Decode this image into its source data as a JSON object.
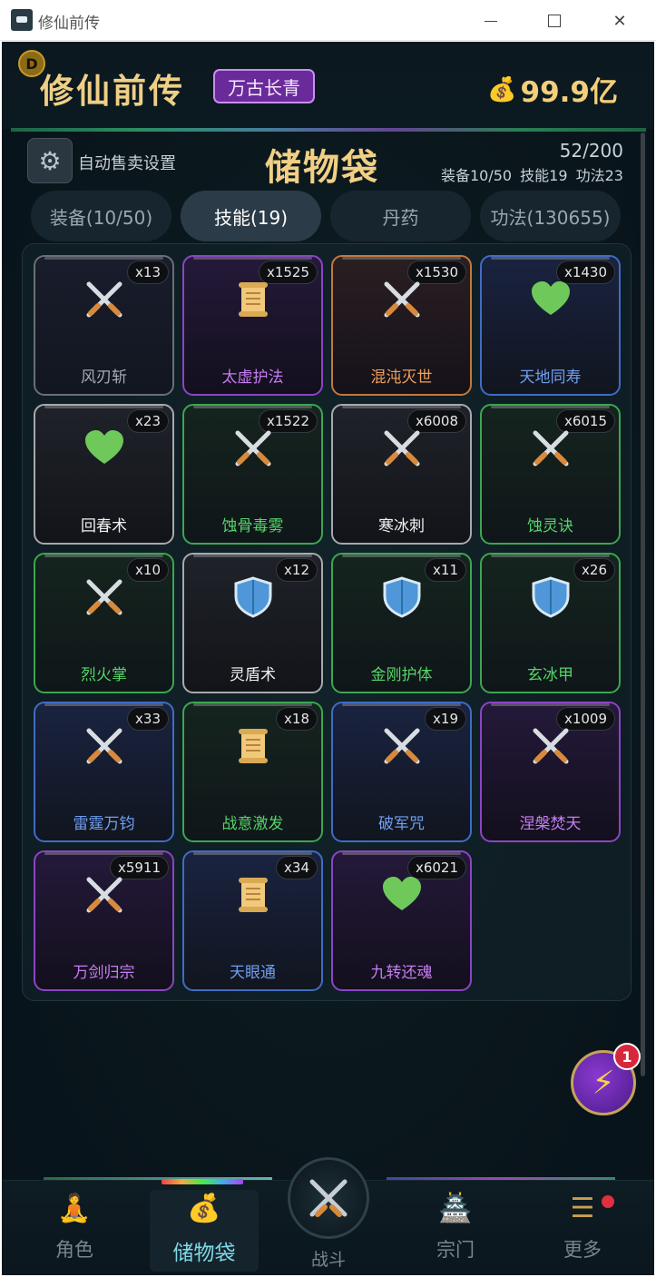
{
  "window": {
    "title": "修仙前传",
    "min": "—",
    "max": "☐",
    "close": "✕"
  },
  "header": {
    "avatar_letter": "D",
    "title": "修仙前传",
    "rank": "万古长青",
    "gold": "99.9亿",
    "gold_icon": "money-bag-icon"
  },
  "bag": {
    "settings_label": "自动售卖设置",
    "title": "储物袋",
    "capacity": "52/200",
    "stats": "装备10/50 技能19 功法23"
  },
  "tabs": [
    {
      "label": "装备(10/50)",
      "active": false
    },
    {
      "label": "技能(19)",
      "active": true
    },
    {
      "label": "丹药",
      "active": false
    },
    {
      "label": "功法(130655)",
      "active": false
    }
  ],
  "items": [
    {
      "name": "风刃斩",
      "qty": "x13",
      "rarity": "gray",
      "icon": "crossed-swords-icon"
    },
    {
      "name": "太虚护法",
      "qty": "x1525",
      "rarity": "purple",
      "icon": "scroll-icon"
    },
    {
      "name": "混沌灭世",
      "qty": "x1530",
      "rarity": "orange",
      "icon": "crossed-swords-icon"
    },
    {
      "name": "天地同寿",
      "qty": "x1430",
      "rarity": "blue",
      "icon": "heart-icon"
    },
    {
      "name": "回春术",
      "qty": "x23",
      "rarity": "white",
      "icon": "heart-icon"
    },
    {
      "name": "蚀骨毒雾",
      "qty": "x1522",
      "rarity": "green",
      "icon": "crossed-swords-icon"
    },
    {
      "name": "寒冰刺",
      "qty": "x6008",
      "rarity": "white",
      "icon": "crossed-swords-icon"
    },
    {
      "name": "蚀灵诀",
      "qty": "x6015",
      "rarity": "green",
      "icon": "crossed-swords-icon"
    },
    {
      "name": "烈火掌",
      "qty": "x10",
      "rarity": "green",
      "icon": "crossed-swords-icon"
    },
    {
      "name": "灵盾术",
      "qty": "x12",
      "rarity": "white",
      "icon": "shield-icon"
    },
    {
      "name": "金刚护体",
      "qty": "x11",
      "rarity": "green",
      "icon": "shield-icon"
    },
    {
      "name": "玄冰甲",
      "qty": "x26",
      "rarity": "green",
      "icon": "shield-icon"
    },
    {
      "name": "雷霆万钧",
      "qty": "x33",
      "rarity": "blue",
      "icon": "crossed-swords-icon"
    },
    {
      "name": "战意激发",
      "qty": "x18",
      "rarity": "green",
      "icon": "scroll-icon"
    },
    {
      "name": "破军咒",
      "qty": "x19",
      "rarity": "blue",
      "icon": "crossed-swords-icon"
    },
    {
      "name": "涅槃焚天",
      "qty": "x1009",
      "rarity": "purple",
      "icon": "crossed-swords-icon"
    },
    {
      "name": "万剑归宗",
      "qty": "x5911",
      "rarity": "purple",
      "icon": "crossed-swords-icon"
    },
    {
      "name": "天眼通",
      "qty": "x34",
      "rarity": "blue",
      "icon": "scroll-icon"
    },
    {
      "name": "九转还魂",
      "qty": "x6021",
      "rarity": "purple",
      "icon": "heart-icon"
    }
  ],
  "fab": {
    "badge": "1",
    "icon": "lightning-icon"
  },
  "nav": {
    "items": [
      {
        "label": "角色",
        "icon": "meditation-icon"
      },
      {
        "label": "储物袋",
        "icon": "bag-icon",
        "active": true
      },
      {
        "label": "战斗",
        "icon": "crossed-swords-icon"
      },
      {
        "label": "宗门",
        "icon": "temple-icon"
      },
      {
        "label": "更多",
        "icon": "menu-icon"
      }
    ]
  },
  "colors": {
    "gold_text": "#efcf86",
    "purple": "#8b45c4",
    "blue": "#3f6cc4",
    "green": "#3ca650",
    "orange": "#c4783a"
  }
}
